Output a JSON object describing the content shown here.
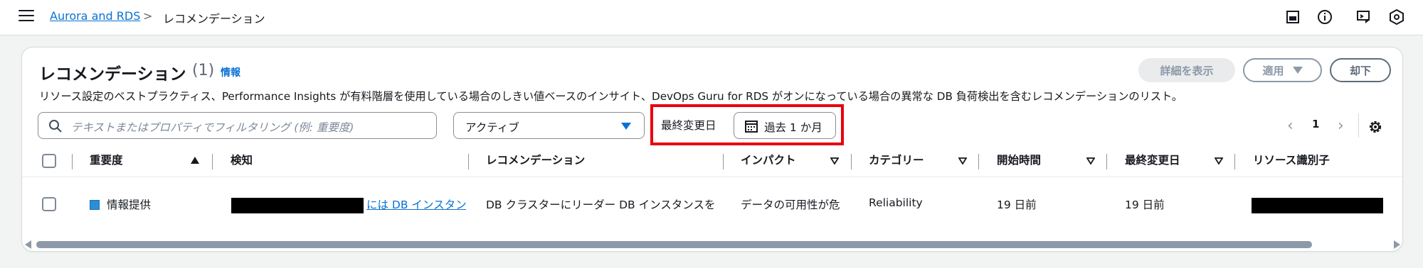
{
  "breadcrumb": {
    "root": "Aurora and RDS",
    "separator": ">",
    "current": "レコメンデーション"
  },
  "top_icons": [
    "panel-icon",
    "info-icon",
    "feedback-icon",
    "settings-hex-icon"
  ],
  "panel": {
    "title": "レコメンデーション",
    "count": "(1)",
    "info_link": "情報",
    "description": "リソース設定のベストプラクティス、Performance Insights が有料階層を使用している場合のしきい値ベースのインサイト、DevOps Guru for RDS がオンになっている場合の異常な DB 負荷検出を含むレコメンデーションのリスト。",
    "buttons": {
      "view_details": "詳細を表示",
      "apply": "適用",
      "dismiss": "却下"
    }
  },
  "filter": {
    "search_placeholder": "テキストまたはプロパティでフィルタリング (例: 重要度)",
    "status_select": "アクティブ",
    "date_label": "最終変更日",
    "date_range": "過去 1 か月"
  },
  "pagination": {
    "page": "1",
    "prev": "‹",
    "next": "›"
  },
  "table": {
    "columns": [
      "重要度",
      "検知",
      "レコメンデーション",
      "インパクト",
      "カテゴリー",
      "開始時間",
      "最終変更日",
      "リソース識別子"
    ],
    "rows": [
      {
        "severity": "情報提供",
        "detection": "には DB インスタン",
        "recommendation": "DB クラスターにリーダー DB インスタンスを",
        "impact": "データの可用性が危",
        "category": "Reliability",
        "start_time": "19 日前",
        "last_modified": "19 日前"
      }
    ]
  },
  "colors": {
    "accent": "#0972d3",
    "highlight": "#e8000d",
    "severity_info": "#2b8fd8"
  }
}
